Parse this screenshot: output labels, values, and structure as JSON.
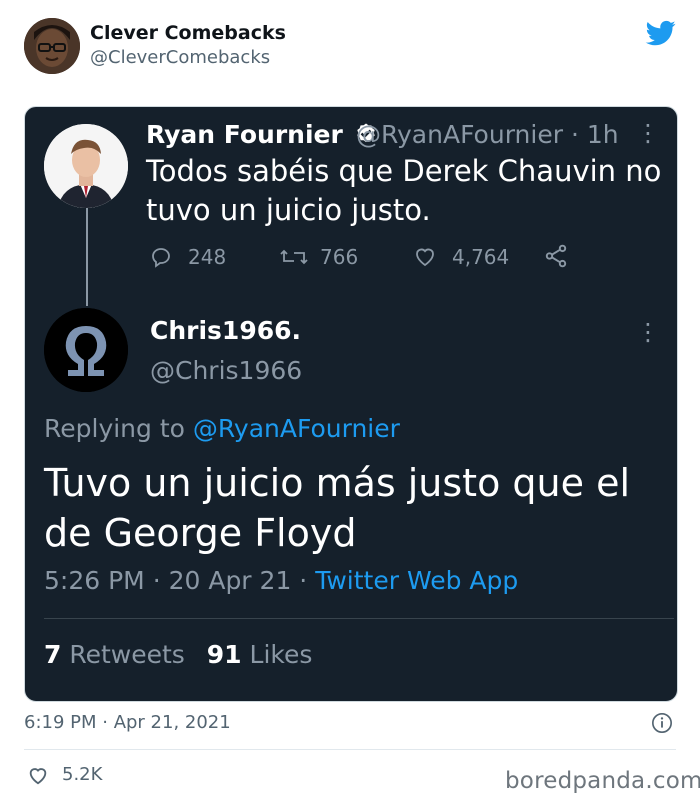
{
  "outer_tweet": {
    "author_name": "Clever Comebacks",
    "author_handle": "@CleverComebacks",
    "timestamp": "6:19 PM · Apr 21, 2021",
    "like_count": "5.2K"
  },
  "screenshot": {
    "parent_tweet": {
      "author_name": "Ryan Fournier",
      "author_handle": "@RyanAFournier",
      "age": "· 1h",
      "text": "Todos sabéis que Derek Chauvin no tuvo un juicio justo.",
      "reply_count": "248",
      "retweet_count": "766",
      "like_count": "4,764"
    },
    "reply_tweet": {
      "author_name": "Chris1966.",
      "author_handle": "@Chris1966",
      "replying_prefix": "Replying to",
      "replying_handle": "@RyanAFournier",
      "text": "Tuvo un juicio más justo que el de George Floyd",
      "time": "5:26 PM",
      "date": "· 20 Apr 21 ·",
      "source": "Twitter Web App",
      "retweets_count": "7",
      "retweets_label": "Retweets",
      "likes_count": "91",
      "likes_label": "Likes"
    }
  },
  "watermark": "boredpanda.com",
  "colors": {
    "dark_bg": "#15202b",
    "twitter_blue": "#1d9bf0",
    "verified_badge": "#ffffff"
  }
}
